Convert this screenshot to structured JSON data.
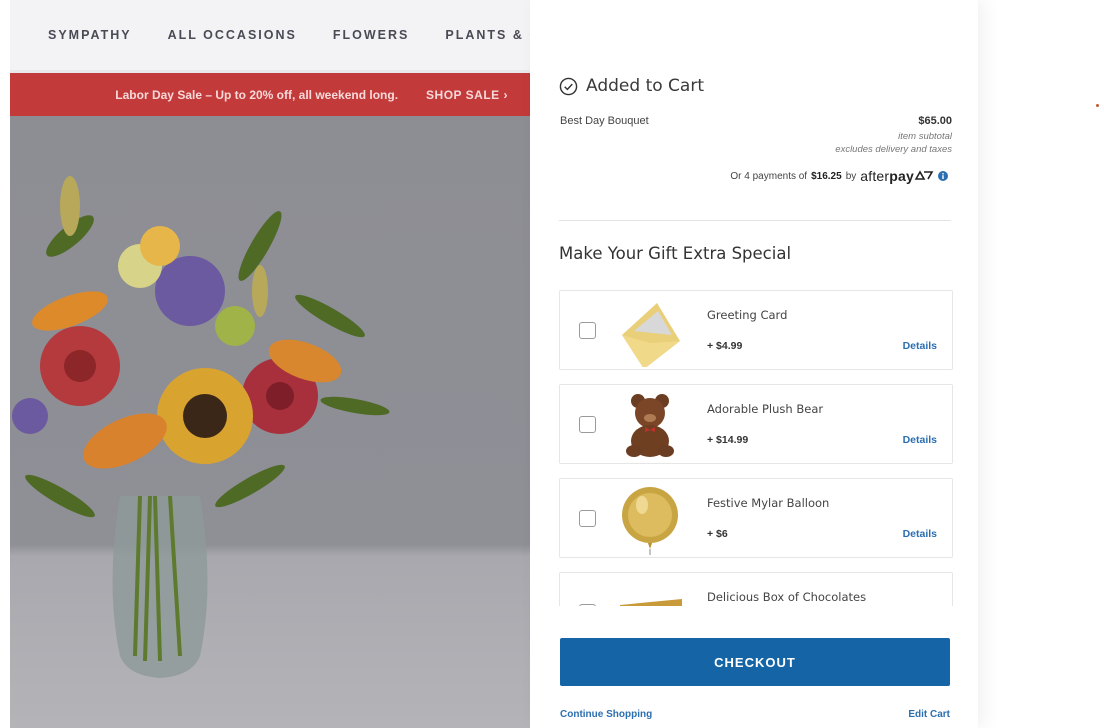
{
  "nav": {
    "items": [
      "SYMPATHY",
      "ALL OCCASIONS",
      "FLOWERS",
      "PLANTS & G"
    ]
  },
  "banner": {
    "message": "Labor Day Sale – Up to 20% off, all weekend long.",
    "cta": "SHOP SALE ›"
  },
  "cart": {
    "status": "Added to Cart",
    "product_name": "Best Day Bouquet",
    "price": "$65.00",
    "subtotal_label": "item subtotal",
    "subtotal_note": "excludes delivery and taxes",
    "afterpay": {
      "prefix": "Or 4 payments of",
      "amount": "$16.25",
      "by": "by",
      "brand_light": "after",
      "brand_bold": "pay"
    }
  },
  "addons": {
    "title": "Make Your Gift Extra Special",
    "items": [
      {
        "name": "Greeting Card",
        "price": "+ $4.99",
        "details": "Details",
        "icon": "greeting-card"
      },
      {
        "name": "Adorable Plush Bear",
        "price": "+ $14.99",
        "details": "Details",
        "icon": "plush-bear"
      },
      {
        "name": "Festive Mylar Balloon",
        "price": "+ $6",
        "details": "Details",
        "icon": "mylar-balloon"
      },
      {
        "name": "Delicious Box of Chocolates",
        "price": "",
        "details": "",
        "icon": "chocolate-box"
      }
    ]
  },
  "actions": {
    "checkout": "CHECKOUT",
    "continue": "Continue Shopping",
    "edit": "Edit Cart"
  },
  "colors": {
    "banner": "#c33a3a",
    "checkout": "#1565a6",
    "link": "#2c6fb0"
  }
}
